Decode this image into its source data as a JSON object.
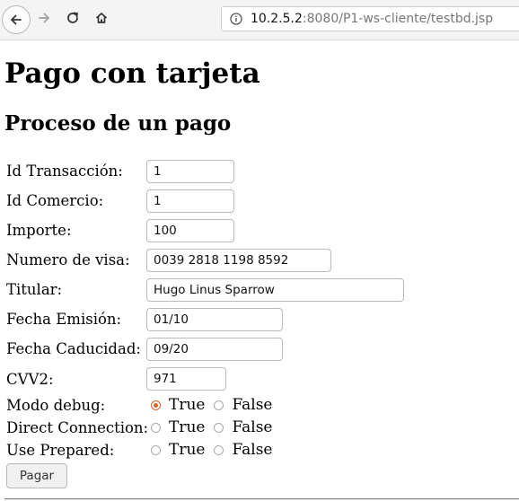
{
  "browser": {
    "url_host": "10.2.5.2",
    "url_rest": ":8080/P1-ws-cliente/testbd.jsp"
  },
  "page": {
    "title": "Pago con tarjeta",
    "subtitle": "Proceso de un pago",
    "fields": {
      "id_transaccion": {
        "label": "Id Transacción:",
        "value": "1"
      },
      "id_comercio": {
        "label": "Id Comercio:",
        "value": "1"
      },
      "importe": {
        "label": "Importe:",
        "value": "100"
      },
      "numero_visa": {
        "label": "Numero de visa:",
        "value": "0039 2818 1198 8592"
      },
      "titular": {
        "label": "Titular:",
        "value": "Hugo Linus Sparrow"
      },
      "fecha_emision": {
        "label": "Fecha Emisión:",
        "value": "01/10"
      },
      "fecha_caducidad": {
        "label": "Fecha Caducidad:",
        "value": "09/20"
      },
      "cvv2": {
        "label": "CVV2:",
        "value": "971"
      }
    },
    "options": {
      "modo_debug": {
        "label": "Modo debug:",
        "true_label": "True",
        "false_label": "False",
        "selected": "True"
      },
      "direct_connection": {
        "label": "Direct Connection:",
        "true_label": "True",
        "false_label": "False",
        "selected": ""
      },
      "use_prepared": {
        "label": "Use Prepared:",
        "true_label": "True",
        "false_label": "False",
        "selected": ""
      }
    },
    "submit_label": "Pagar",
    "accent_color": "#d9642e"
  }
}
